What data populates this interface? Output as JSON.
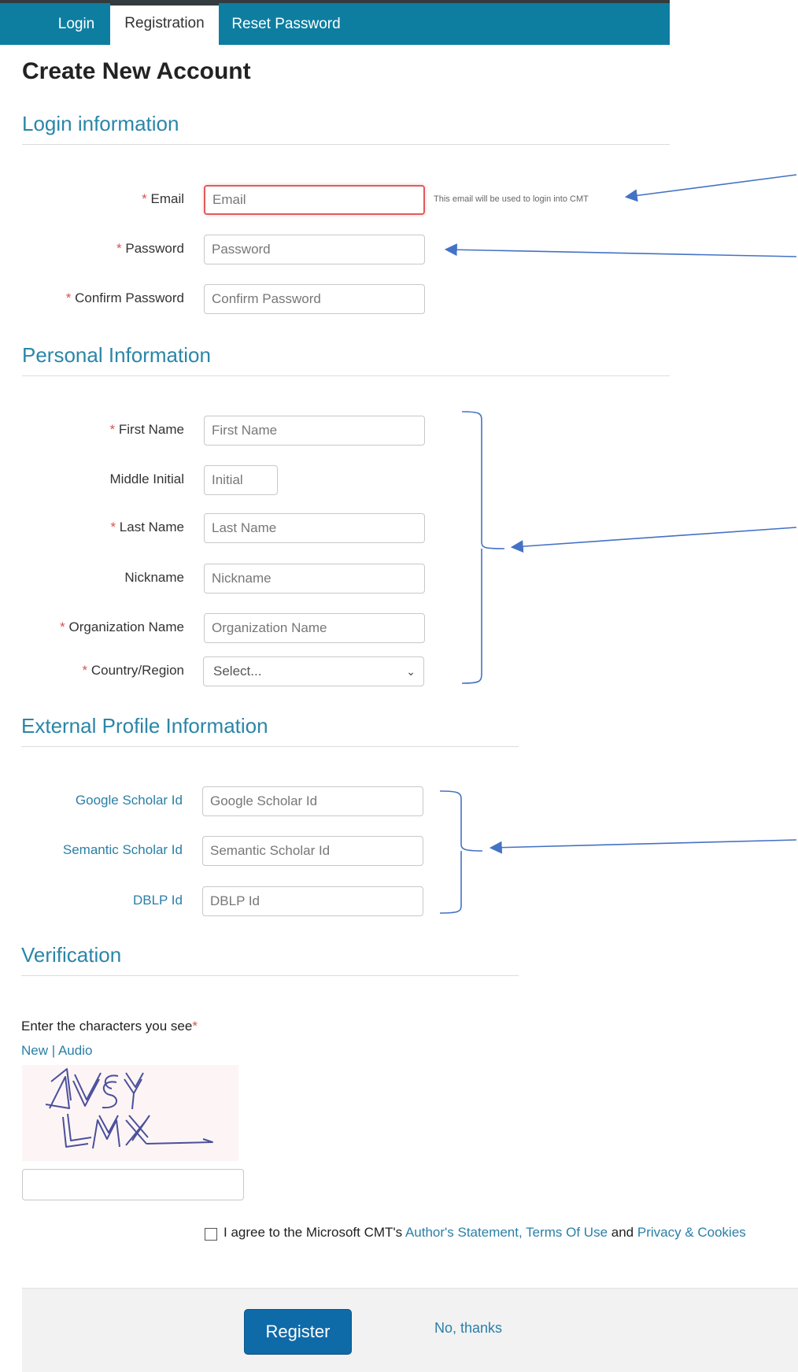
{
  "nav": {
    "tabs": [
      {
        "label": "Login"
      },
      {
        "label": "Registration"
      },
      {
        "label": "Reset Password"
      }
    ]
  },
  "page_title": "Create New Account",
  "login_section": {
    "title": "Login information",
    "email": {
      "label": "Email",
      "placeholder": "Email",
      "hint": "This email will be used to login into CMT"
    },
    "password": {
      "label": "Password",
      "placeholder": "Password"
    },
    "confirm_password": {
      "label": "Confirm Password",
      "placeholder": "Confirm Password"
    }
  },
  "personal_section": {
    "title": "Personal Information",
    "first_name": {
      "label": "First Name",
      "placeholder": "First Name"
    },
    "middle_initial": {
      "label": "Middle Initial",
      "placeholder": "Initial"
    },
    "last_name": {
      "label": "Last Name",
      "placeholder": "Last Name"
    },
    "nickname": {
      "label": "Nickname",
      "placeholder": "Nickname"
    },
    "organization": {
      "label": "Organization Name",
      "placeholder": "Organization Name"
    },
    "country": {
      "label": "Country/Region",
      "selected": "Select..."
    }
  },
  "external_section": {
    "title": "External Profile Information",
    "google": {
      "label": "Google Scholar Id",
      "placeholder": "Google Scholar Id"
    },
    "semantic": {
      "label": "Semantic Scholar Id",
      "placeholder": "Semantic Scholar Id"
    },
    "dblp": {
      "label": "DBLP Id",
      "placeholder": "DBLP Id"
    }
  },
  "verification_section": {
    "title": "Verification",
    "prompt": "Enter the characters you see",
    "new_link": "New",
    "separator": " | ",
    "audio_link": "Audio",
    "captcha_text": "4VSY LMX"
  },
  "agreement": {
    "prefix": "I agree to the Microsoft CMT's ",
    "authors_statement": "Author's Statement,",
    "terms": "Terms Of Use",
    "and": " and ",
    "privacy": "Privacy & Cookies"
  },
  "actions": {
    "register": "Register",
    "no_thanks": "No, thanks"
  },
  "required_marker": "*",
  "colors": {
    "nav_bg": "#0e7ea0",
    "section_title": "#2a86a8",
    "link": "#2a7fa7",
    "required": "#d9534f",
    "button": "#0f6aa8",
    "annotation": "#4472c4"
  }
}
